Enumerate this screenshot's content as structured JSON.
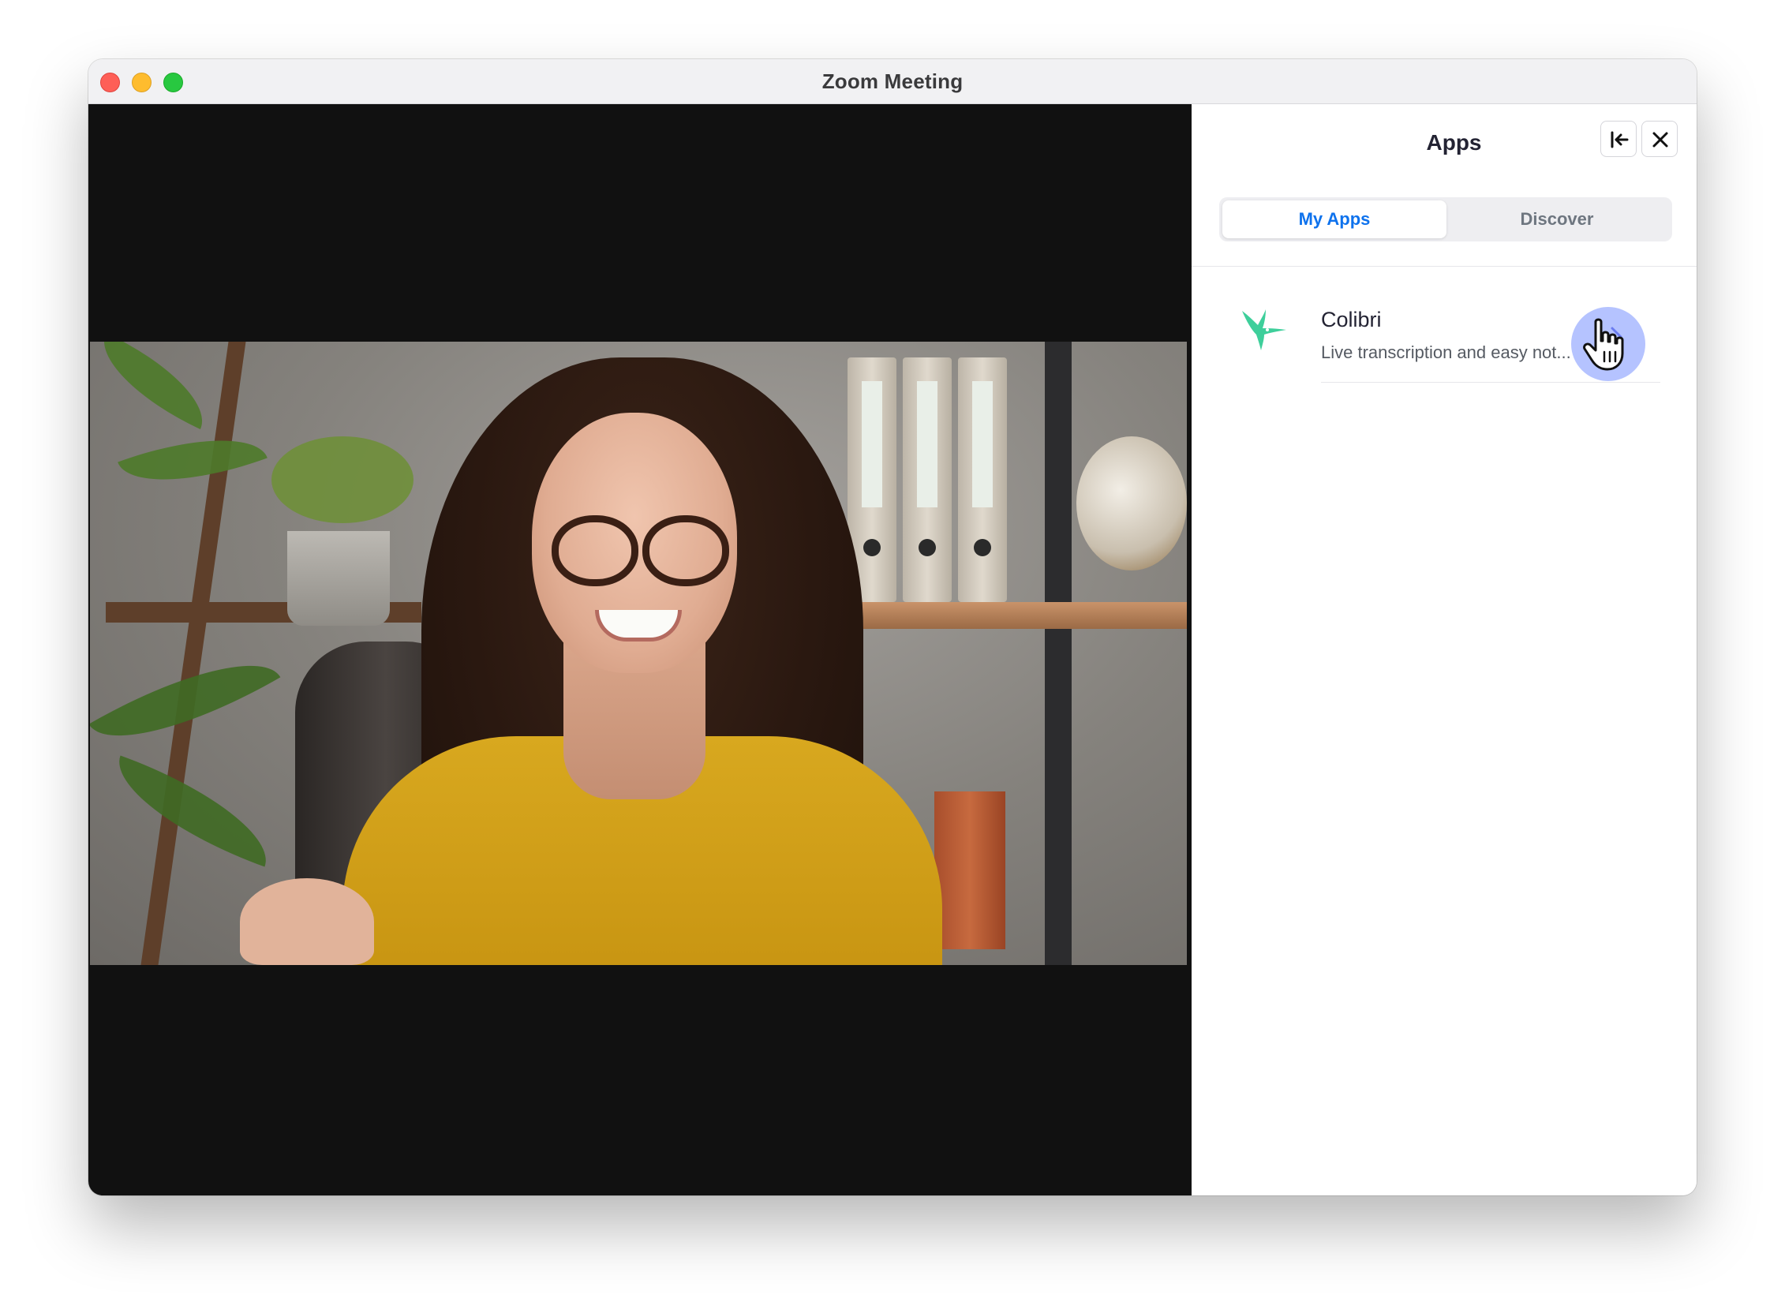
{
  "window": {
    "title": "Zoom Meeting"
  },
  "apps_panel": {
    "title": "Apps",
    "collapse_icon": "collapse-left-icon",
    "close_icon": "close-icon",
    "tabs": [
      {
        "label": "My Apps",
        "active": true
      },
      {
        "label": "Discover",
        "active": false
      }
    ],
    "apps": [
      {
        "name": "Colibri",
        "description": "Live transcription and easy not...",
        "logo_icon": "hummingbird-icon",
        "logo_color": "#3ecf9b",
        "open_icon": "chevron-right-icon"
      }
    ]
  },
  "colors": {
    "accent": "#0e72ed",
    "hover_highlight": "#8fa2ff"
  }
}
